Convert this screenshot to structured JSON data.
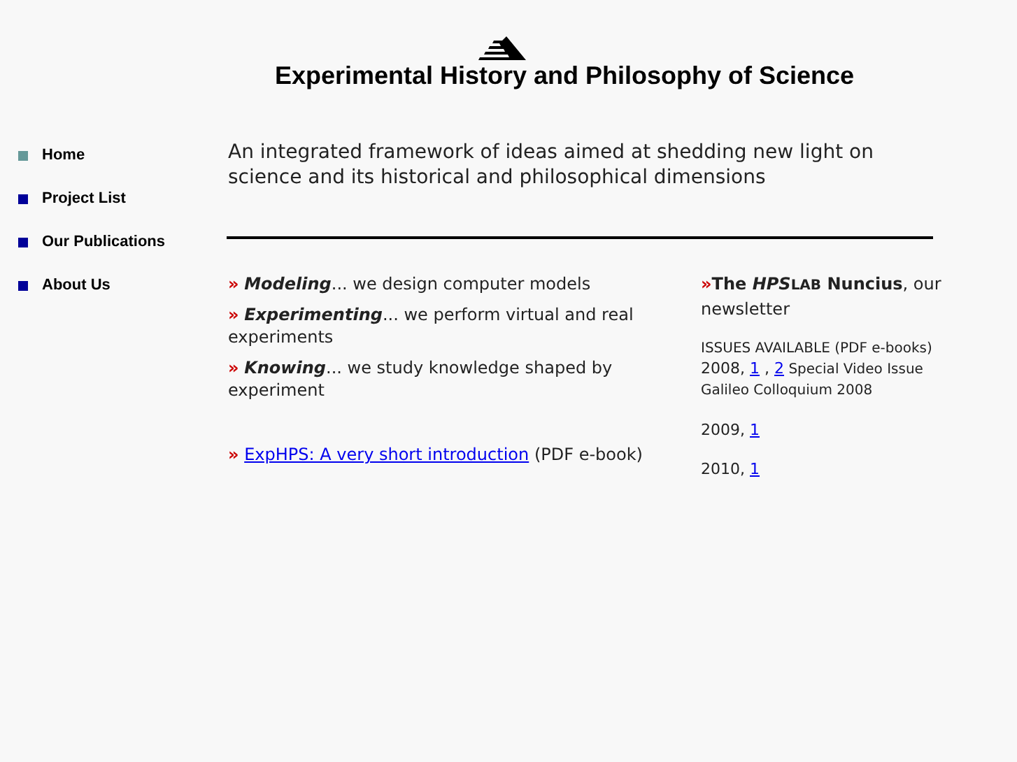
{
  "site_title": "Experimental History and Philosophy of Science",
  "nav": [
    {
      "label": "Home",
      "selected": true
    },
    {
      "label": "Project List",
      "selected": false
    },
    {
      "label": "Our Publications",
      "selected": false
    },
    {
      "label": "About Us",
      "selected": false
    }
  ],
  "intro": "An integrated framework of ideas aimed at shedding new light on science and its historical and philosophical dimensions",
  "activities": [
    {
      "marker": "»",
      "term": "Modeling",
      "text": "... we design computer models"
    },
    {
      "marker": "»",
      "term": "Experimenting",
      "text": "... we perform virtual and real experiments"
    },
    {
      "marker": "»",
      "term": "Knowing",
      "text": "... we study knowledge shaped by experiment"
    }
  ],
  "ebook": {
    "marker": "»",
    "link": "ExpHPS: A very short introduction",
    "note": "(PDF e-book)"
  },
  "newsletter": {
    "marker": "»",
    "the": "The",
    "hps": "HPS",
    "lab": "LAB",
    "name": "Nuncius",
    "rest": ", our newsletter"
  },
  "issues_heading": "ISSUES AVAILABLE (PDF e-books)",
  "issues": [
    {
      "year": "2008,",
      "links": [
        "1",
        "2"
      ],
      "separator": ",",
      "note": "Special Video Issue Galileo Colloquium 2008"
    },
    {
      "year": "2009,",
      "links": [
        "1"
      ]
    },
    {
      "year": "2010,",
      "links": [
        "1"
      ]
    }
  ]
}
